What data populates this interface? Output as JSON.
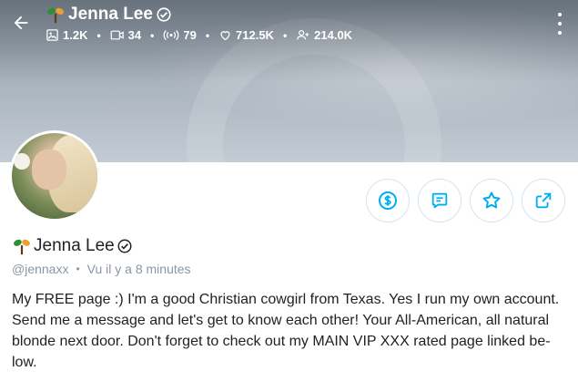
{
  "header": {
    "name": "Jenna Lee",
    "stats": [
      {
        "icon": "image-icon",
        "value": "1.2K"
      },
      {
        "icon": "video-icon",
        "value": "34"
      },
      {
        "icon": "live-icon",
        "value": "79"
      },
      {
        "icon": "heart-icon",
        "value": "712.5K"
      },
      {
        "icon": "fans-icon",
        "value": "214.0K"
      }
    ]
  },
  "profile": {
    "name": "Jenna Lee",
    "username": "@jennaxx",
    "last_seen": "Vu  il y a 8 minutes",
    "bio_lines": [
      "My FREE page :) I'm a good Christian cowgirl from Texas. Yes I run my own account.",
      "Send me a message and let's get to know each other! Your All-American, all natural",
      "blonde next door. Don't forget to check out my MAIN VIP XXX rated page linked be-",
      "low."
    ]
  },
  "actions": [
    "tip-button",
    "message-button",
    "favorite-button",
    "share-button"
  ],
  "colors": {
    "accent": "#00aff0",
    "muted": "#8a96a3",
    "verified_badge": "#ffffff",
    "sprout_green": "#2f8f2f",
    "sprout_orange": "#f0a030"
  }
}
